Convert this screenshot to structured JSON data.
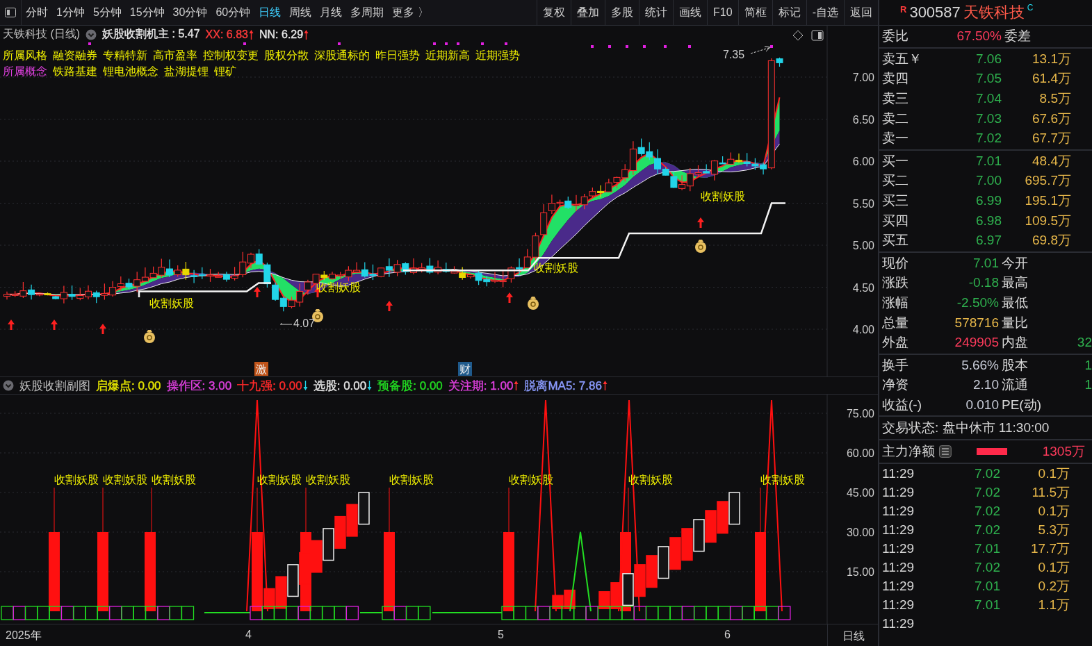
{
  "toolbar": {
    "periods": [
      {
        "label": "分时",
        "selected": false
      },
      {
        "label": "1分钟",
        "selected": false
      },
      {
        "label": "5分钟",
        "selected": false
      },
      {
        "label": "15分钟",
        "selected": false
      },
      {
        "label": "30分钟",
        "selected": false
      },
      {
        "label": "60分钟",
        "selected": false
      },
      {
        "label": "日线",
        "selected": true
      },
      {
        "label": "周线",
        "selected": false
      },
      {
        "label": "月线",
        "selected": false
      },
      {
        "label": "多周期",
        "selected": false
      },
      {
        "label": "更多 〉",
        "selected": false
      }
    ],
    "tools": [
      "复权",
      "叠加",
      "多股",
      "统计",
      "画线",
      "F10",
      "简框",
      "标记",
      "-自选",
      "返回"
    ]
  },
  "stock_header": {
    "marker": "R",
    "code": "300587",
    "name": "天铁科技",
    "badge": "C"
  },
  "main_chart": {
    "title": "天铁科技 (日线)",
    "readings": [
      {
        "label": "妖股收割机主 :",
        "value": "5.47",
        "color": "#e6e6e6",
        "kind": "plain"
      },
      {
        "label": "XX:",
        "value": "6.83",
        "color": "#ff3b3b",
        "kind": "up"
      },
      {
        "label": "NN:",
        "value": "6.29",
        "color": "#e6e6e6",
        "kind": "up"
      }
    ],
    "style_label": "所属风格",
    "styles": [
      "融资融券",
      "专精特新",
      "高市盈率",
      "控制权变更",
      "股权分散",
      "深股通标的",
      "昨日强势",
      "近期新高",
      "近期强势"
    ],
    "concept_label": "所属概念",
    "concepts": [
      "铁路基建",
      "锂电池概念",
      "盐湖提锂",
      "锂矿"
    ],
    "y_labels": [
      "7.00",
      "6.50",
      "6.00",
      "5.50",
      "5.00",
      "4.50",
      "4.00"
    ],
    "high_note": "7.35",
    "low_note": "4.07",
    "signal_labels": [
      "收割妖股",
      "收割妖股",
      "收割妖股",
      "收割妖股"
    ],
    "events": [
      {
        "label": "激",
        "color": "#c0541a"
      },
      {
        "label": "财",
        "color": "#1f5a8c"
      }
    ]
  },
  "sub_chart": {
    "title": "妖股收割副图",
    "readings": [
      {
        "label": "启爆点:",
        "value": "0.00",
        "color": "#e6e600",
        "kind": "plain"
      },
      {
        "label": "操作区:",
        "value": "3.00",
        "color": "#e040e0",
        "kind": "plain"
      },
      {
        "label": "十九强:",
        "value": "0.00",
        "color": "#ff2a2a",
        "kind": "down"
      },
      {
        "label": "选股:",
        "value": "0.00",
        "color": "#e6e6e6",
        "kind": "down"
      },
      {
        "label": "预备股:",
        "value": "0.00",
        "color": "#22dd22",
        "kind": "plain"
      },
      {
        "label": "关注期:",
        "value": "1.00",
        "color": "#e040e0",
        "kind": "up"
      },
      {
        "label": "脱离MA5:",
        "value": "7.86",
        "color": "#8c9cff",
        "kind": "up"
      }
    ],
    "y_labels": [
      "75.00",
      "60.00",
      "45.00",
      "30.00",
      "15.00"
    ],
    "signal_labels": [
      "收割妖股",
      "收割妖股",
      "收割妖股",
      "收割妖股",
      "收割妖股",
      "收割妖股",
      "收割妖股",
      "收割妖股",
      "收割妖股"
    ]
  },
  "x_axis": {
    "labels": [
      "2025年",
      "4",
      "5",
      "6"
    ],
    "period": "日线"
  },
  "quote": {
    "ratio": {
      "label": "委比",
      "value": "67.50%",
      "label2": "委差"
    },
    "asks": [
      {
        "label": "卖五￥",
        "price": "7.06",
        "volume": "13.1万"
      },
      {
        "label": "卖四",
        "price": "7.05",
        "volume": "61.4万"
      },
      {
        "label": "卖三",
        "price": "7.04",
        "volume": "8.5万"
      },
      {
        "label": "卖二",
        "price": "7.03",
        "volume": "67.6万"
      },
      {
        "label": "卖一",
        "price": "7.02",
        "volume": "67.7万"
      }
    ],
    "bids": [
      {
        "label": "买一",
        "price": "7.01",
        "volume": "48.4万"
      },
      {
        "label": "买二",
        "price": "7.00",
        "volume": "695.7万"
      },
      {
        "label": "买三",
        "price": "6.99",
        "volume": "195.1万"
      },
      {
        "label": "买四",
        "price": "6.98",
        "volume": "109.5万"
      },
      {
        "label": "买五",
        "price": "6.97",
        "volume": "69.8万"
      }
    ],
    "stats": [
      {
        "label": "现价",
        "value": "7.01",
        "color": "#2fb34f",
        "label2": "今开"
      },
      {
        "label": "涨跌",
        "value": "-0.18",
        "color": "#2fb34f",
        "label2": "最高"
      },
      {
        "label": "涨幅",
        "value": "-2.50%",
        "color": "#2fb34f",
        "label2": "最低"
      },
      {
        "label": "总量",
        "value": "578716",
        "color": "#e8b84a",
        "label2": "量比"
      },
      {
        "label": "外盘",
        "value": "249905",
        "color": "#ff3b5c",
        "label2": "内盘",
        "value2": "32"
      }
    ],
    "stats2": [
      {
        "label": "换手",
        "value": "5.66%",
        "color": "#c8ccd8",
        "label2": "股本",
        "value2": "1"
      },
      {
        "label": "净资",
        "value": "2.10",
        "color": "#c8ccd8",
        "label2": "流通",
        "value2": "1"
      },
      {
        "label": "收益(-)",
        "value": "0.010",
        "color": "#c8ccd8",
        "label2": "PE(动)"
      }
    ],
    "status": "交易状态: 盘中休市 11:30:00",
    "net": {
      "label": "主力净额",
      "amount": "1305万",
      "level": 0.5
    },
    "ticks": [
      {
        "time": "11:29",
        "price": "7.02",
        "volume": "0.1万"
      },
      {
        "time": "11:29",
        "price": "7.02",
        "volume": "11.5万"
      },
      {
        "time": "11:29",
        "price": "7.02",
        "volume": "0.1万"
      },
      {
        "time": "11:29",
        "price": "7.02",
        "volume": "5.3万"
      },
      {
        "time": "11:29",
        "price": "7.01",
        "volume": "17.7万"
      },
      {
        "time": "11:29",
        "price": "7.02",
        "volume": "0.1万"
      },
      {
        "time": "11:29",
        "price": "7.01",
        "volume": "0.2万"
      },
      {
        "time": "11:29",
        "price": "7.01",
        "volume": "1.1万"
      },
      {
        "time": "11:29"
      }
    ]
  }
}
